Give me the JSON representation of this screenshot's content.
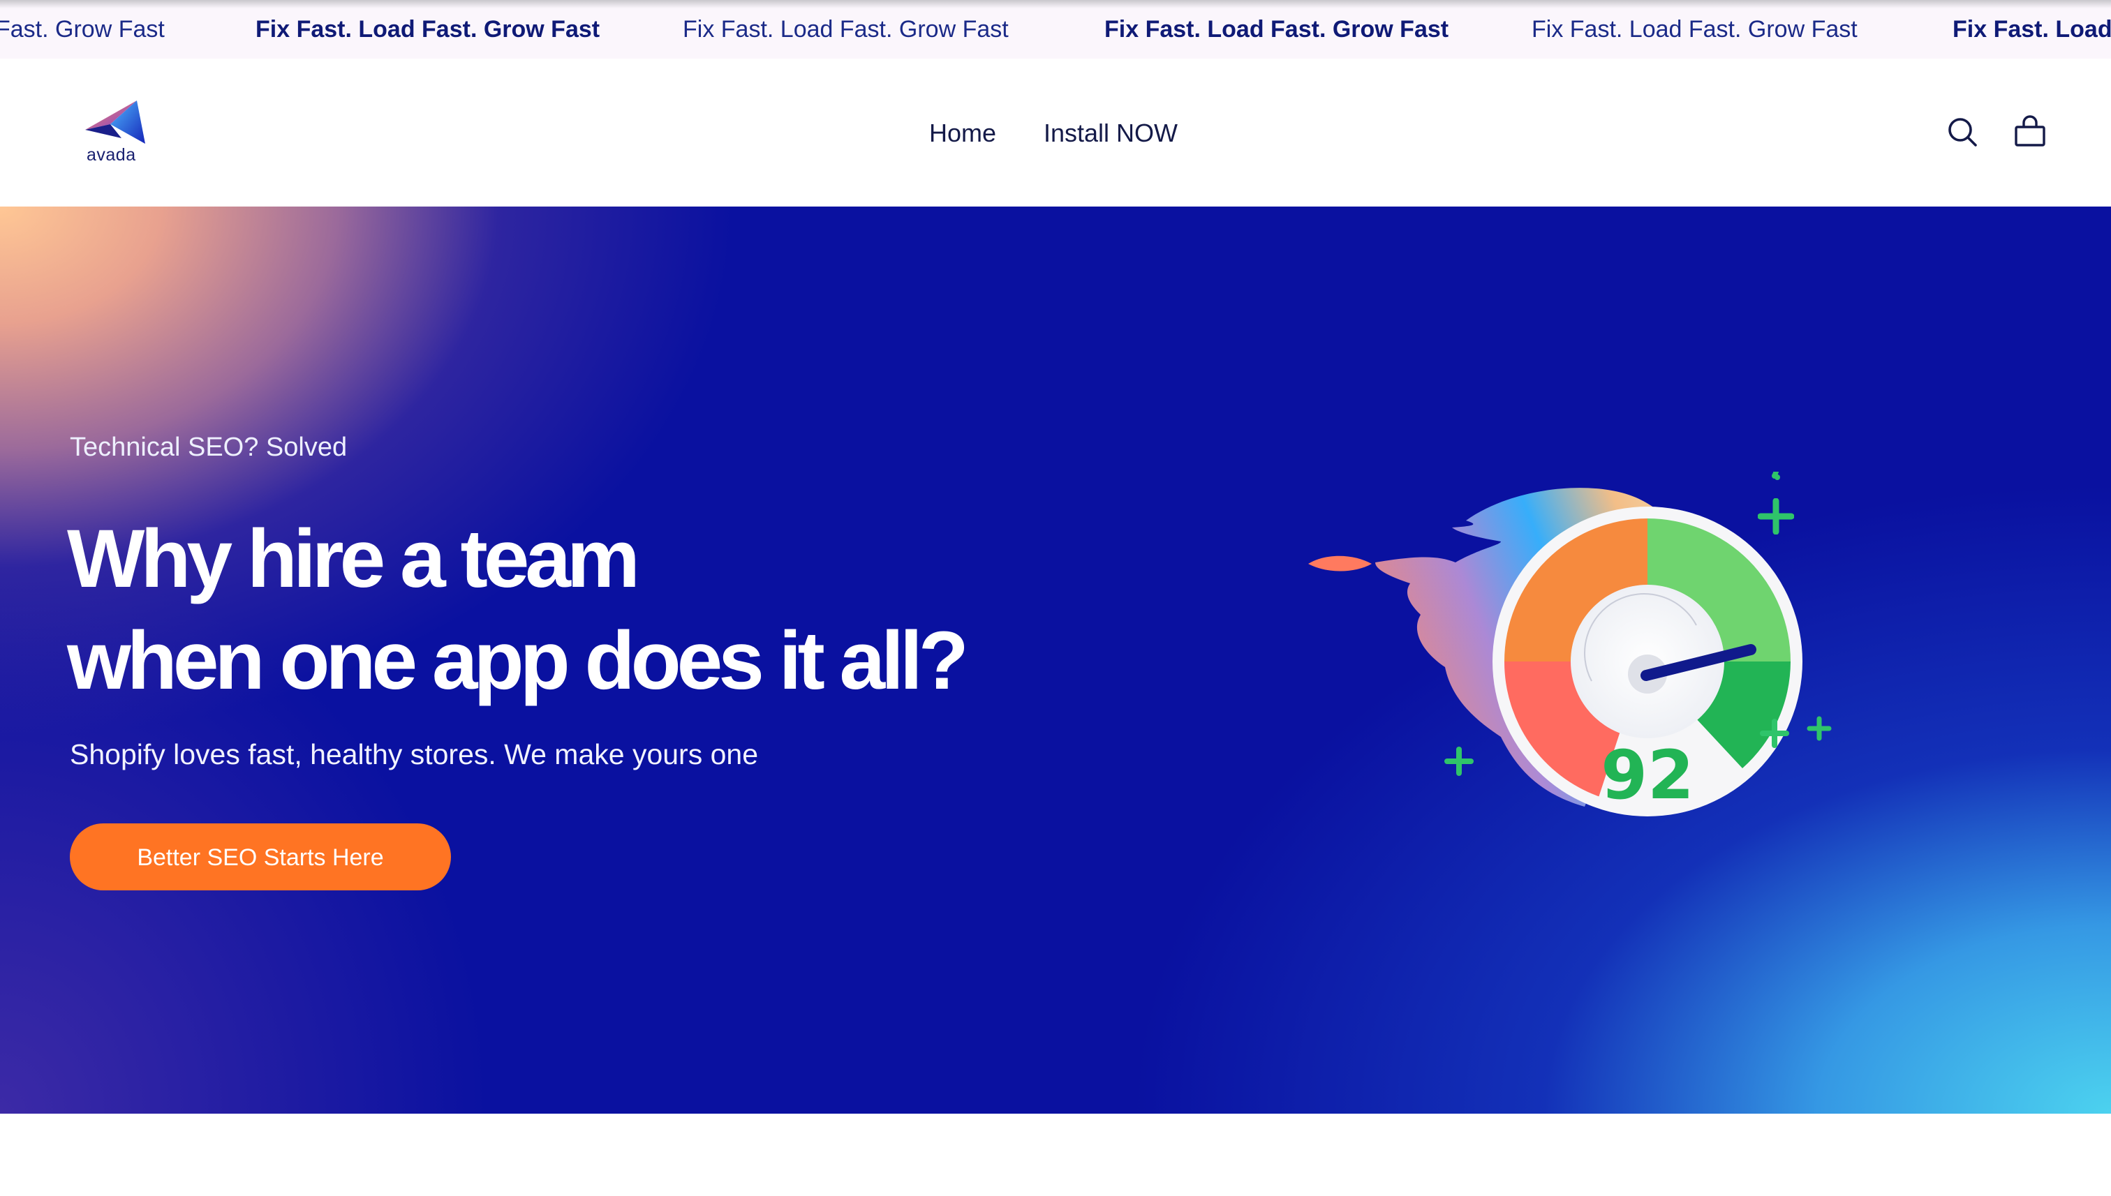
{
  "announcement": {
    "items": [
      {
        "text": "Fast. Grow Fast",
        "bold": false
      },
      {
        "text": "Fix Fast. Load Fast. Grow Fast",
        "bold": true
      },
      {
        "text": "Fix Fast. Load Fast. Grow Fast",
        "bold": false
      },
      {
        "text": "Fix Fast. Load Fast. Grow Fast",
        "bold": true
      },
      {
        "text": "Fix Fast. Load Fast. Grow Fast",
        "bold": false
      },
      {
        "text": "Fix Fast. Load",
        "bold": true
      }
    ]
  },
  "header": {
    "logo_text": "avada",
    "nav": [
      "Home",
      "Install NOW"
    ],
    "icons": [
      "search-icon",
      "cart-icon"
    ]
  },
  "hero": {
    "eyebrow": "Technical SEO? Solved",
    "headline_line1": "Why hire a team",
    "headline_line2": "when one app does it all?",
    "subline": "Shopify loves fast, healthy stores. We make yours one",
    "cta_label": "Better SEO Starts Here",
    "speed_score": "92"
  },
  "colors": {
    "accent_cta": "#ff7423",
    "brand_navy": "#0f1a76",
    "score_green": "#22b455"
  }
}
